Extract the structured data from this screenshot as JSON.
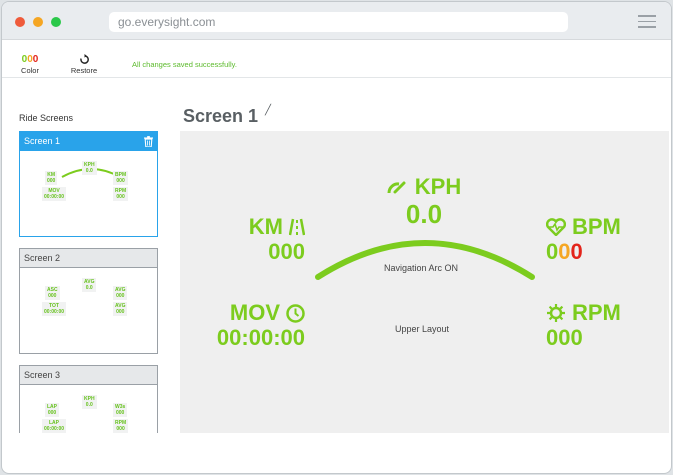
{
  "browser": {
    "url": "go.everysight.com"
  },
  "toolbar": {
    "color_digits": [
      "0",
      "0",
      "0"
    ],
    "color_label": "Color",
    "restore_label": "Restore",
    "status_message": "All changes saved successfully."
  },
  "sidebar": {
    "title": "Ride Screens",
    "screens": [
      {
        "name": "Screen 1",
        "widgets": [
          {
            "label": "KM",
            "value": "000"
          },
          {
            "label": "KPH",
            "value": "0.0"
          },
          {
            "label": "BPM",
            "value": "000"
          },
          {
            "label": "MOV",
            "value": "00:00:00"
          },
          {
            "label": "RPM",
            "value": "000"
          }
        ]
      },
      {
        "name": "Screen 2",
        "widgets": [
          {
            "label": "ASC",
            "value": "000"
          },
          {
            "label": "AVG",
            "value": "0.0"
          },
          {
            "label": "AVG",
            "value": "000"
          },
          {
            "label": "TOT",
            "value": "00:00:00"
          },
          {
            "label": "AVG",
            "value": "000"
          }
        ]
      },
      {
        "name": "Screen 3",
        "widgets": [
          {
            "label": "LAP",
            "value": "000"
          },
          {
            "label": "KPH",
            "value": "0.0"
          },
          {
            "label": "W3s",
            "value": "000"
          },
          {
            "label": "LAP",
            "value": "00:00:00"
          },
          {
            "label": "RPM",
            "value": "000"
          }
        ]
      }
    ]
  },
  "main": {
    "title": "Screen 1",
    "edit_icon": "pencil-icon",
    "widgets": {
      "speed": {
        "label": "KPH",
        "value": "0.0",
        "icon": "speedometer-icon"
      },
      "distance": {
        "label": "KM",
        "value": "000",
        "icon": "road-icon"
      },
      "heart": {
        "label": "BPM",
        "value_digits": [
          "0",
          "0",
          "0"
        ],
        "icon": "heart-pulse-icon"
      },
      "moving": {
        "label": "MOV",
        "value": "00:00:00",
        "icon": "clock-icon"
      },
      "cadence": {
        "label": "RPM",
        "value": "000",
        "icon": "gear-icon"
      }
    },
    "arc_caption": "Navigation Arc ON",
    "layout_caption": "Upper Layout"
  },
  "colors": {
    "accent_green": "#7ccc1e",
    "active_blue": "#29a3ea",
    "digit_orange": "#f5a623",
    "digit_red": "#e3241b"
  }
}
